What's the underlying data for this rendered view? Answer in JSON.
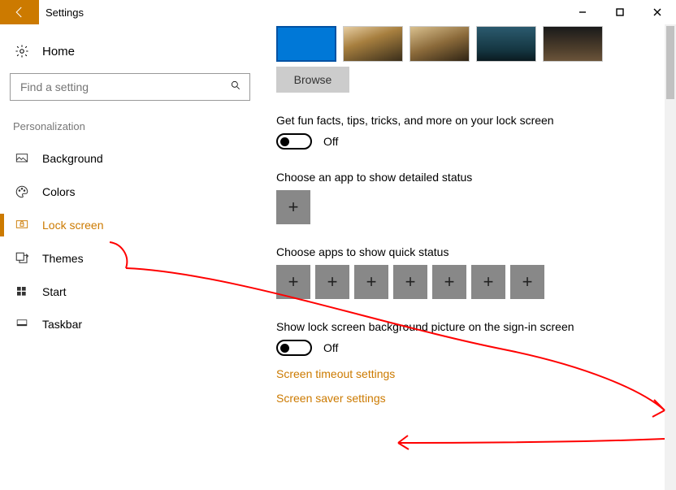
{
  "window": {
    "title": "Settings"
  },
  "sidebar": {
    "home": "Home",
    "search_placeholder": "Find a setting",
    "section": "Personalization",
    "items": [
      {
        "label": "Background"
      },
      {
        "label": "Colors"
      },
      {
        "label": "Lock screen"
      },
      {
        "label": "Themes"
      },
      {
        "label": "Start"
      },
      {
        "label": "Taskbar"
      }
    ]
  },
  "main": {
    "browse": "Browse",
    "fun_facts_label": "Get fun facts, tips, tricks, and more on your lock screen",
    "fun_facts_state": "Off",
    "detailed_label": "Choose an app to show detailed status",
    "quick_label": "Choose apps to show quick status",
    "bg_signin_label": "Show lock screen background picture on the sign-in screen",
    "bg_signin_state": "Off",
    "link_timeout": "Screen timeout settings",
    "link_saver": "Screen saver settings"
  }
}
